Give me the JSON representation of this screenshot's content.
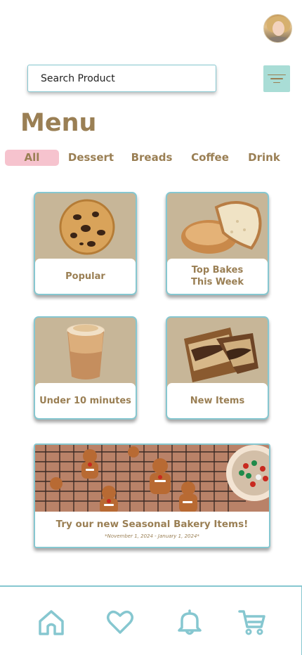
{
  "header": {
    "avatar_icon": "user-avatar"
  },
  "search": {
    "placeholder": "Search Product",
    "value": ""
  },
  "filter": {
    "icon": "filter-icon"
  },
  "menu": {
    "title": "Menu"
  },
  "categories": [
    {
      "label": "All",
      "active": true
    },
    {
      "label": "Dessert",
      "active": false
    },
    {
      "label": "Breads",
      "active": false
    },
    {
      "label": "Coffee",
      "active": false
    },
    {
      "label": "Drink",
      "active": false
    }
  ],
  "cards": [
    {
      "label": "Popular",
      "image": "cookie"
    },
    {
      "label": "Top Bakes\nThis Week",
      "image": "bread"
    },
    {
      "label": "Under 10 minutes",
      "image": "iced-coffee"
    },
    {
      "label": "New Items",
      "image": "marble-cake"
    }
  ],
  "banner": {
    "title": "Try our new Seasonal Bakery Items!",
    "dates": "*November 1, 2024 - January 1, 2024*",
    "image": "gingerbread-cookies"
  },
  "bottom_nav": [
    {
      "name": "home-icon"
    },
    {
      "name": "heart-icon"
    },
    {
      "name": "bell-icon"
    },
    {
      "name": "cart-icon"
    }
  ],
  "colors": {
    "accent": "#86c7d0",
    "brown": "#9a7f54",
    "active_pill": "#f6c3ce",
    "card_bg": "#c7b698",
    "filter_bg": "#a9ddd6"
  }
}
